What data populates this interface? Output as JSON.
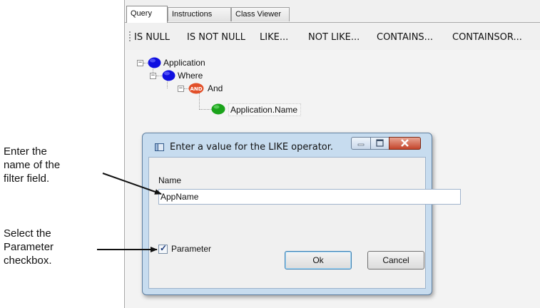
{
  "annotations": {
    "callout_1": [
      "Enter the",
      "name of the",
      "filter field."
    ],
    "callout_2": [
      "Select the",
      "Parameter",
      "checkbox."
    ]
  },
  "tabs": [
    {
      "label": "Query",
      "active": true
    },
    {
      "label": "Instructions",
      "active": false
    },
    {
      "label": "Class Viewer",
      "active": false
    }
  ],
  "toolbar": {
    "operators": [
      "IS NULL",
      "IS NOT NULL",
      "LIKE...",
      "NOT LIKE...",
      "CONTAINS...",
      "CONTAINSOR..."
    ]
  },
  "tree": {
    "nodes": [
      {
        "label": "Application",
        "icon": "blue-circle-icon",
        "color": "#1010e0"
      },
      {
        "label": "Where",
        "icon": "blue-circle-icon",
        "color": "#1010e0"
      },
      {
        "label": "And",
        "icon": "and-operator-icon",
        "color": "#e2502a",
        "badge": "AND"
      },
      {
        "label": "Application.Name",
        "icon": "green-circle-icon",
        "color": "#1aa31a"
      }
    ]
  },
  "dialog": {
    "title": "Enter a value for the LIKE operator.",
    "name_label": "Name",
    "name_value": "AppName",
    "parameter_label": "Parameter",
    "parameter_checked": true,
    "ok_label": "Ok",
    "cancel_label": "Cancel"
  }
}
